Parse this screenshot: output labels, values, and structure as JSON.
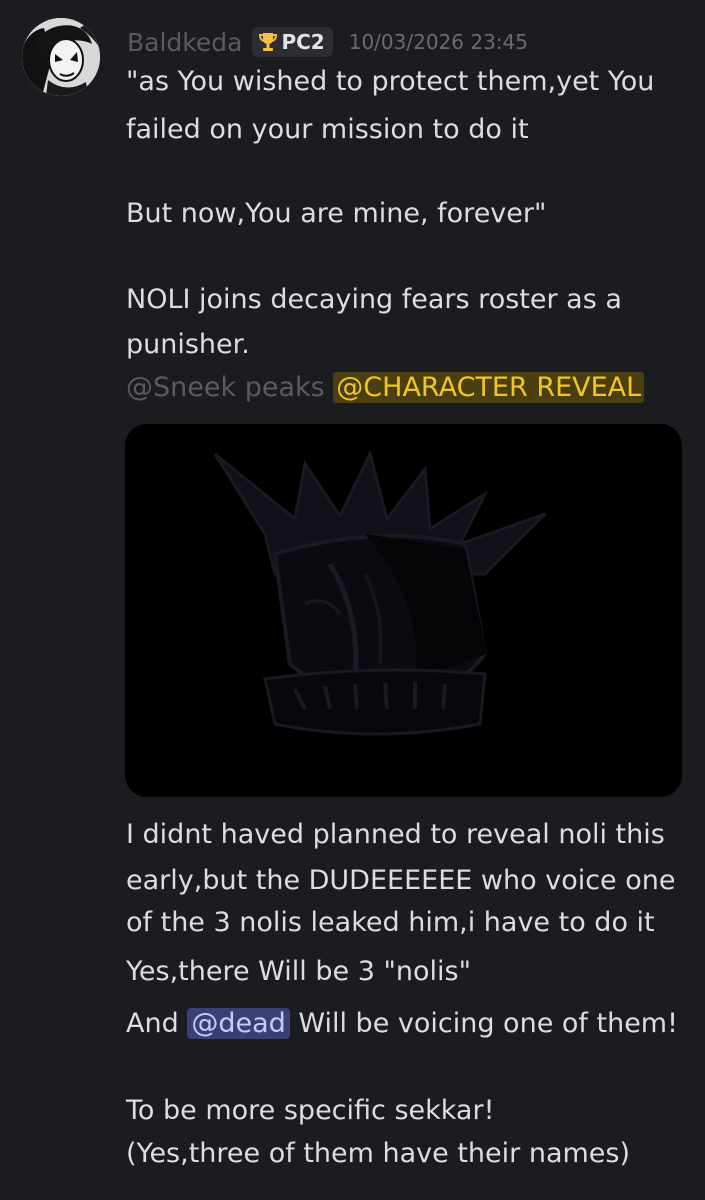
{
  "author": {
    "username": "Baldkeda",
    "role_badge": "PC2",
    "role_icon": "trophy-icon",
    "timestamp": "10/03/2026 23:45"
  },
  "message": {
    "quote_line_1": "\"as You wished to protect them,yet You",
    "quote_line_2": "failed on your mission to do it",
    "quote_line_3": "But now,You are mine, forever\"",
    "announce_line_1": "NOLI joins decaying fears roster as a",
    "announce_line_2": "punisher.",
    "mention_sneek": "@Sneek peaks",
    "mention_reveal": "@CHARACTER REVEAL",
    "body_line_1": "I didnt haved planned to reveal noli this",
    "body_line_2": "early,but the DUDEEEEEE who voice one",
    "body_line_3": "of the 3 nolis leaked him,i have to do it",
    "body_line_4": "Yes,there Will be 3 \"nolis\"",
    "body_line_5_prefix": "And",
    "mention_dead": "@dead",
    "body_line_5_suffix": "Will be voicing one of them!",
    "body_line_6": "To be more specific sekkar!",
    "body_line_7": "(Yes,three of them have their names)"
  },
  "colors": {
    "background": "#1b1c20",
    "text": "#dcdde1",
    "muted": "#5a5b60",
    "role_mention_bg": "#4b3f10",
    "role_mention_fg": "#f2c524",
    "user_mention_bg": "#3b3f75",
    "user_mention_fg": "#c5cbff"
  }
}
